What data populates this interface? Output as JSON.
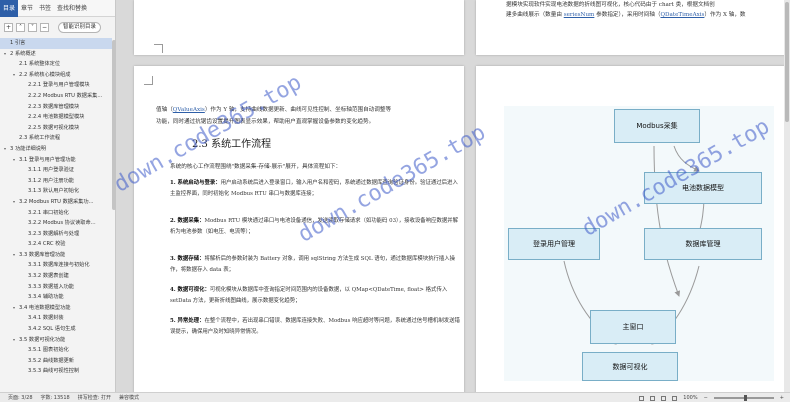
{
  "nav": {
    "tabs": [
      "目录",
      "章节",
      "书签",
      "查找和替换"
    ],
    "smart_toc_label": "智能识别目录",
    "items": [
      {
        "label": "1 引言",
        "level": 0,
        "arrow": "",
        "selected": true
      },
      {
        "label": "2 系统概述",
        "level": 0,
        "arrow": "▾"
      },
      {
        "label": "2.1 系统整体定位",
        "level": 1,
        "arrow": ""
      },
      {
        "label": "2.2 系统核心模块组成",
        "level": 1,
        "arrow": "▾"
      },
      {
        "label": "2.2.1 登录与用户管理模块",
        "level": 2,
        "arrow": ""
      },
      {
        "label": "2.2.2 Modbus RTU 数据采集...",
        "level": 2,
        "arrow": ""
      },
      {
        "label": "2.2.3 数据库管理模块",
        "level": 2,
        "arrow": ""
      },
      {
        "label": "2.2.4 电池数据模型模块",
        "level": 2,
        "arrow": ""
      },
      {
        "label": "2.2.5 数据可视化模块",
        "level": 2,
        "arrow": ""
      },
      {
        "label": "2.3 系统工作流程",
        "level": 1,
        "arrow": ""
      },
      {
        "label": "3 功能详细说明",
        "level": 0,
        "arrow": "▾"
      },
      {
        "label": "3.1 登录与用户管理功能",
        "level": 1,
        "arrow": "▾"
      },
      {
        "label": "3.1.1 用户登录验证",
        "level": 2,
        "arrow": ""
      },
      {
        "label": "3.1.2 用户注册功能",
        "level": 2,
        "arrow": ""
      },
      {
        "label": "3.1.3 默认用户初始化",
        "level": 2,
        "arrow": ""
      },
      {
        "label": "3.2 Modbus RTU 数据采集功...",
        "level": 1,
        "arrow": "▾"
      },
      {
        "label": "3.2.1 串口初始化",
        "level": 2,
        "arrow": ""
      },
      {
        "label": "3.2.2 Modbus 协议读取命...",
        "level": 2,
        "arrow": ""
      },
      {
        "label": "3.2.3 数据解析与处理",
        "level": 2,
        "arrow": ""
      },
      {
        "label": "3.2.4 CRC 校验",
        "level": 2,
        "arrow": ""
      },
      {
        "label": "3.3 数据库管理功能",
        "level": 1,
        "arrow": "▾"
      },
      {
        "label": "3.3.1 数据库连接与初始化",
        "level": 2,
        "arrow": ""
      },
      {
        "label": "3.3.2 数据表创建",
        "level": 2,
        "arrow": ""
      },
      {
        "label": "3.3.3 数据插入功能",
        "level": 2,
        "arrow": ""
      },
      {
        "label": "3.3.4 辅助功能",
        "level": 2,
        "arrow": ""
      },
      {
        "label": "3.4 电池数据模型功能",
        "level": 1,
        "arrow": "▾"
      },
      {
        "label": "3.4.1 数据封装",
        "level": 2,
        "arrow": ""
      },
      {
        "label": "3.4.2 SQL 语句生成",
        "level": 2,
        "arrow": ""
      },
      {
        "label": "3.5 数据可视化功能",
        "level": 1,
        "arrow": "▾"
      },
      {
        "label": "3.5.1 图表初始化",
        "level": 2,
        "arrow": ""
      },
      {
        "label": "3.5.2 曲线数据更新",
        "level": 2,
        "arrow": ""
      },
      {
        "label": "3.5.3 曲线可视性控制",
        "level": 2,
        "arrow": ""
      }
    ]
  },
  "pages": {
    "p2_line1": "据模块实现软件实现电池数据的折线图可视化，核心代码由于 chart 类，根据文档创",
    "p2_line2_a": "建多曲线展示（数量由 ",
    "p2_line2_code": "seriesNum",
    "p2_line2_b": " 参数指定），采用时间轴（",
    "p2_line2_code2": "QDateTimeAxis",
    "p2_line2_c": "）作为 X 轴，数",
    "p3_intro1_a": "值轴（",
    "p3_intro1_code": "QValueAxis",
    "p3_intro1_b": "）作为 Y 轴，支持曲线数据更新、曲线可见性控制、坐标轴范围自动调整等",
    "p3_intro2": "功能，同时通过抗锯齿设置提升图表显示效果，帮助用户直观掌握设备参数的变化趋势。",
    "heading": "2.3  系统工作流程",
    "lead": "系统的核心工作流程围绕\"数据采集-存储-展示\"展开，具体流程如下：",
    "steps": [
      {
        "title": "1. 系统启动与登录：",
        "text": "用户启动系统后进入登录窗口，输入用户名和密码，系统通过数据库查询验证身份。验证通过后进入主监控界面，同时初始化 Modbus RTU 串口与数据库连接；"
      },
      {
        "title": "2. 数据采集：",
        "text": "Modbus RTU 模块通过串口与电池设备通信，发送读取存储请求（如功能码 03），接收设备响应数据并解析为电池参数（如电压、电流等）；"
      },
      {
        "title": "3. 数据存储：",
        "text": "将解析后的参数封装为 Battery 对象，调用 sqlString 方法生成 SQL 语句，通过数据库模块执行插入操作，将数据存入 data 表；"
      },
      {
        "title": "4. 数据可视化：",
        "text": "可视化模块从数据库中查询指定时间范围内的设备数据，以 QMap<QDateTime, float> 格式传入 setData 方法，更新折线图曲线，展示数据变化趋势；"
      },
      {
        "title": "5. 异常处理：",
        "text": "在整个流程中，若出现串口错误、数据库连接失败、Modbus 响应超时等问题，系统通过信号槽机制发送错误提示，确保用户及时知晓异常情况。"
      }
    ]
  },
  "diagram": {
    "nodes": {
      "modbus": "Modbus采集",
      "battery": "电池数据模型",
      "login": "登录用户管理",
      "database": "数据库管理",
      "main": "主窗口",
      "viz": "数据可视化"
    },
    "node_fill": "#d9edf6",
    "node_border": "#79aec7",
    "background": "#f3f9fb"
  },
  "watermark": {
    "text": "down.code365.top",
    "color": "#3c5ac8"
  },
  "status": {
    "page": "页面: 3/28",
    "words": "字数: 13518",
    "spell": "拼写检查: 打开",
    "mode": "兼容模式",
    "zoom": "100%"
  }
}
